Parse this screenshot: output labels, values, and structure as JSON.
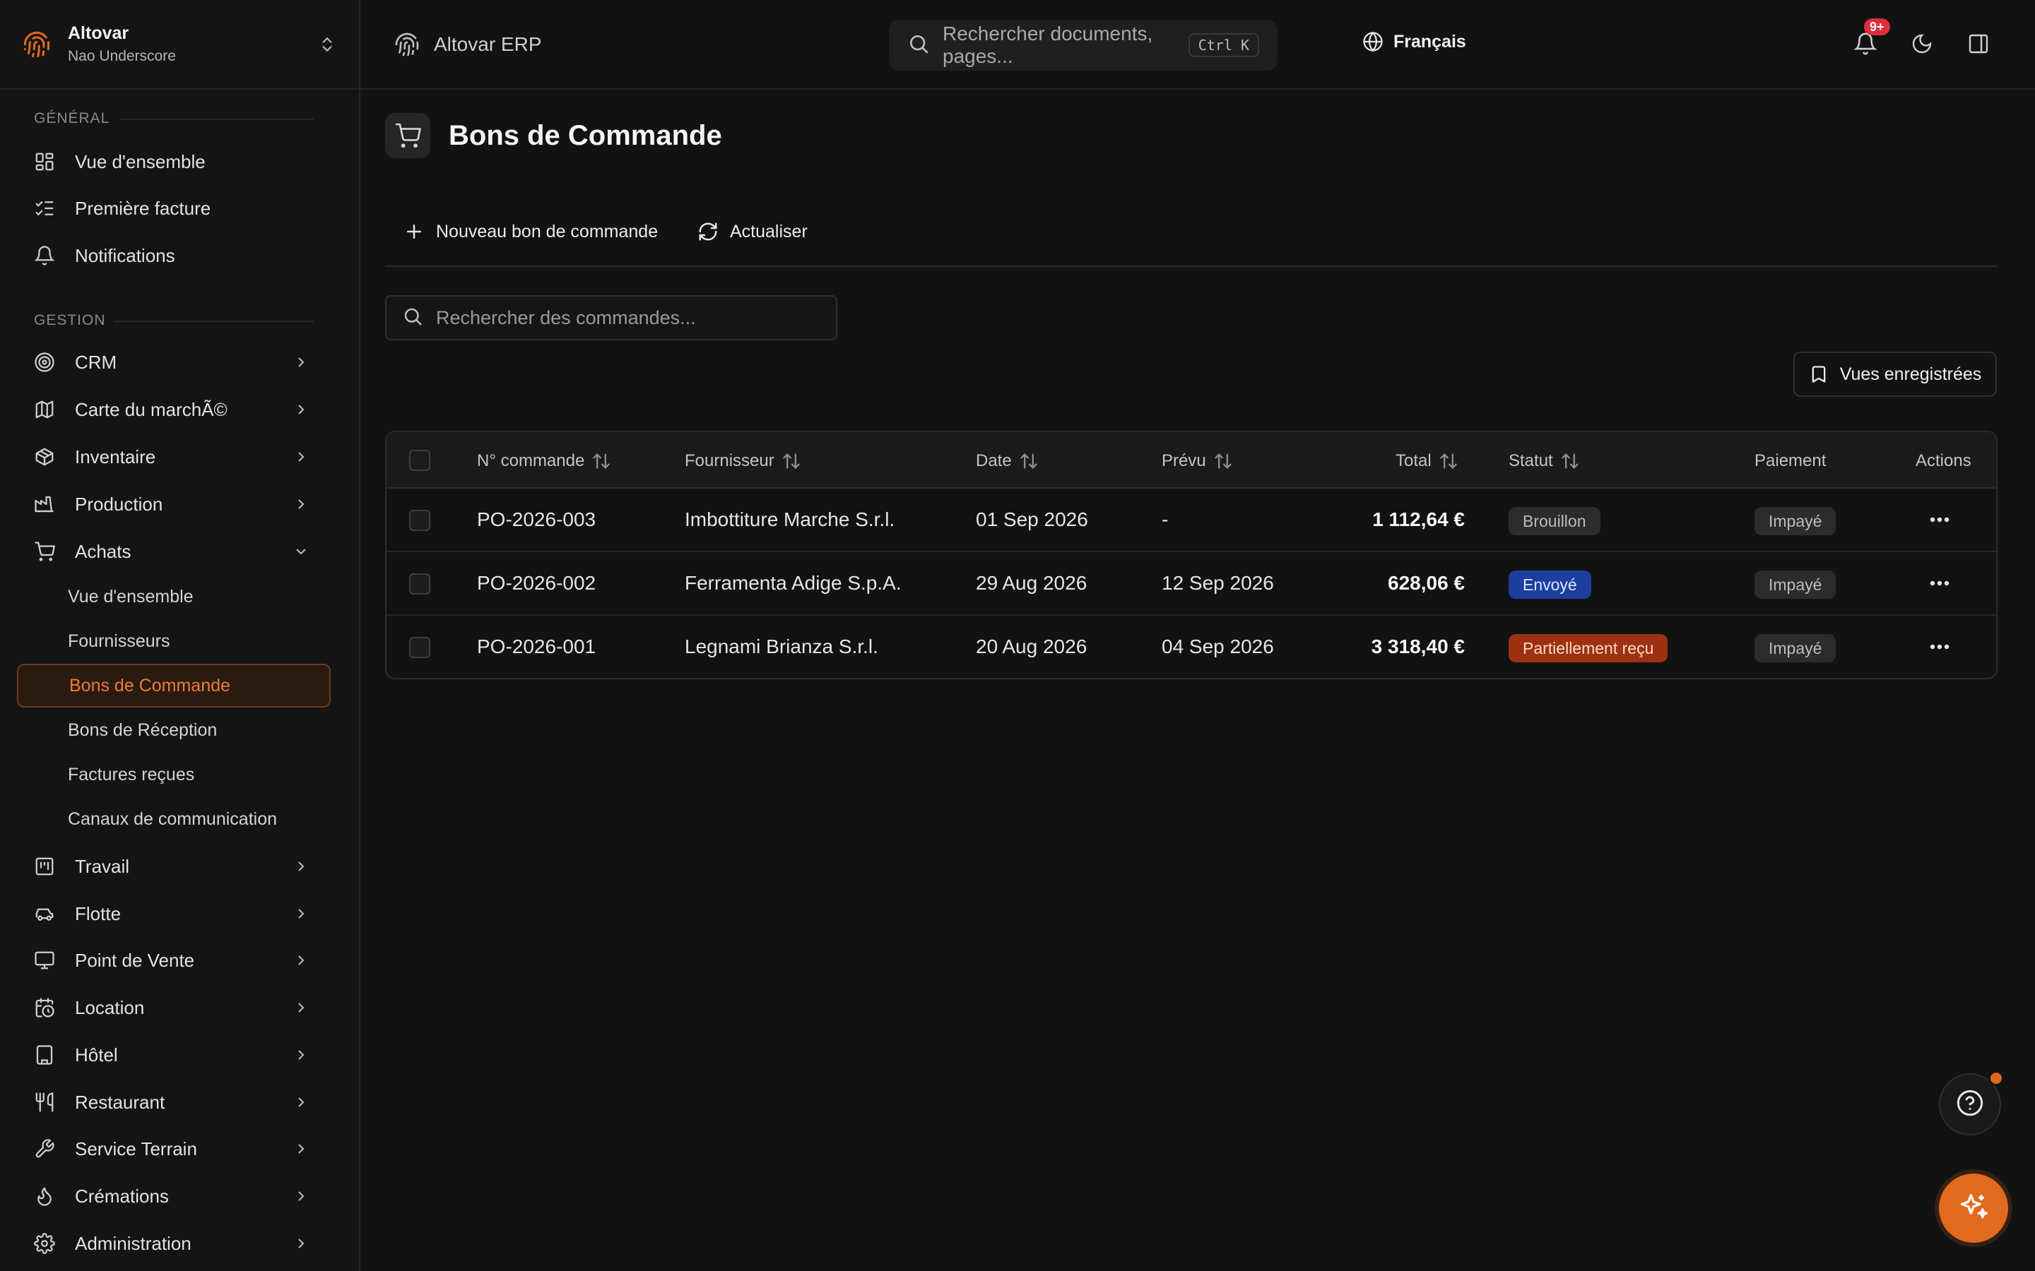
{
  "team": {
    "name": "Altovar",
    "user": "Nao Underscore"
  },
  "sidebar": {
    "general_label": "GÉNÉRAL",
    "general_items": [
      {
        "label": "Vue d'ensemble",
        "icon": "dashboard-icon"
      },
      {
        "label": "Première facture",
        "icon": "checklist-icon"
      },
      {
        "label": "Notifications",
        "icon": "bell-icon"
      }
    ],
    "gestion_label": "GESTION",
    "gestion_items": [
      {
        "label": "CRM",
        "icon": "target-icon"
      },
      {
        "label": "Carte du marchÃ©",
        "icon": "map-icon"
      },
      {
        "label": "Inventaire",
        "icon": "package-icon"
      },
      {
        "label": "Production",
        "icon": "factory-icon"
      },
      {
        "label": "Achats",
        "icon": "cart-icon",
        "expanded": true
      }
    ],
    "achats_sub": [
      {
        "label": "Vue d'ensemble"
      },
      {
        "label": "Fournisseurs"
      },
      {
        "label": "Bons de Commande",
        "active": true
      },
      {
        "label": "Bons de Réception"
      },
      {
        "label": "Factures reçues"
      },
      {
        "label": "Canaux de communication"
      }
    ],
    "more_items": [
      {
        "label": "Travail",
        "icon": "kanban-icon"
      },
      {
        "label": "Flotte",
        "icon": "car-icon"
      },
      {
        "label": "Point de Vente",
        "icon": "monitor-icon"
      },
      {
        "label": "Location",
        "icon": "calendar-clock-icon"
      },
      {
        "label": "Hôtel",
        "icon": "building-icon"
      },
      {
        "label": "Restaurant",
        "icon": "utensils-icon"
      },
      {
        "label": "Service Terrain",
        "icon": "wrench-icon"
      },
      {
        "label": "Crémations",
        "icon": "flame-icon"
      },
      {
        "label": "Administration",
        "icon": "gear-icon"
      }
    ]
  },
  "topbar": {
    "brand": "Altovar ERP",
    "search_placeholder": "Rechercher documents, pages...",
    "shortcut": "Ctrl K",
    "language": "Français",
    "notif_badge": "9+"
  },
  "page": {
    "title": "Bons de Commande",
    "new_button": "Nouveau bon de commande",
    "refresh_button": "Actualiser",
    "search_placeholder": "Rechercher des commandes...",
    "saved_views": "Vues enregistrées"
  },
  "table": {
    "columns": [
      "N° commande",
      "Fournisseur",
      "Date",
      "Prévu",
      "Total",
      "Statut",
      "Paiement",
      "Actions"
    ],
    "rows": [
      {
        "number": "PO-2026-003",
        "supplier": "Imbottiture Marche S.r.l.",
        "date": "01 Sep 2026",
        "expected": "-",
        "total": "1 112,64 €",
        "status": "Brouillon",
        "status_color": "#2c2c2c",
        "payment": "Impayé"
      },
      {
        "number": "PO-2026-002",
        "supplier": "Ferramenta Adige S.p.A.",
        "date": "29 Aug 2026",
        "expected": "12 Sep 2026",
        "total": "628,06 €",
        "status": "Envoyé",
        "status_color": "#1c3e9e",
        "payment": "Impayé"
      },
      {
        "number": "PO-2026-001",
        "supplier": "Legnami Brianza S.r.l.",
        "date": "20 Aug 2026",
        "expected": "04 Sep 2026",
        "total": "3 318,40 €",
        "status": "Partiellement reçu",
        "status_color": "#9c3211",
        "payment": "Impayé"
      }
    ]
  },
  "colors": {
    "accent": "#e06a1e",
    "background": "#121212",
    "sidebar": "#141414"
  }
}
